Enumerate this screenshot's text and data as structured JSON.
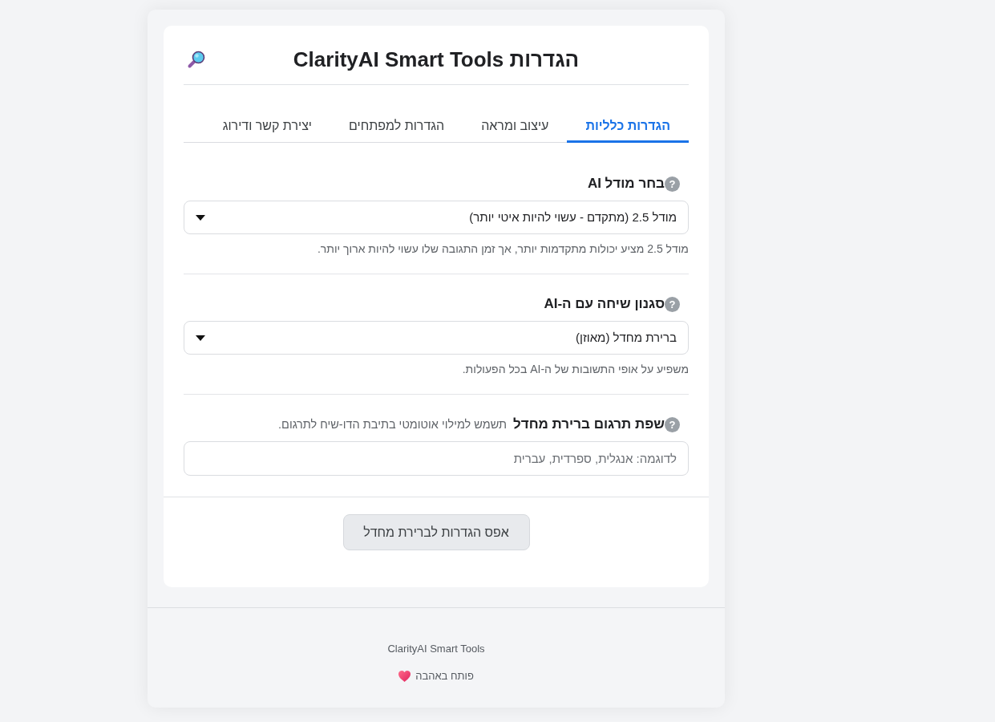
{
  "header": {
    "title": "הגדרות ClarityAI Smart Tools"
  },
  "tabs": [
    {
      "label": "הגדרות כלליות",
      "selected": true
    },
    {
      "label": "עיצוב ומראה",
      "selected": false
    },
    {
      "label": "הגדרות למפתחים",
      "selected": false
    },
    {
      "label": "יצירת קשר ודירוג",
      "selected": false
    }
  ],
  "settings": [
    {
      "kind": "select",
      "help_mark": "?",
      "label": "בחר מודל AI",
      "value": "מודל 2.5 (מתקדם - עשוי להיות איטי יותר)",
      "help": "מודל 2.5 מציע יכולות מתקדמות יותר, אך זמן התגובה שלו עשוי להיות ארוך יותר."
    },
    {
      "kind": "select",
      "help_mark": "?",
      "label": "סגנון שיחה עם ה-AI",
      "value": "ברירת מחדל (מאוזן)",
      "help": "משפיע על אופי התשובות של ה-AI בכל הפעולות."
    },
    {
      "kind": "text",
      "help_mark": "?",
      "label": "שפת תרגום ברירת מחדל",
      "note": "תשמש למילוי אוטומטי בתיבת הדו-שיח לתרגום.",
      "placeholder": "לדוגמה: אנגלית, ספרדית, עברית"
    }
  ],
  "reset_button": "אפס הגדרות לברירת מחדל",
  "footer": {
    "app_name": "ClarityAI Smart Tools",
    "credit": "פותח באהבה"
  }
}
